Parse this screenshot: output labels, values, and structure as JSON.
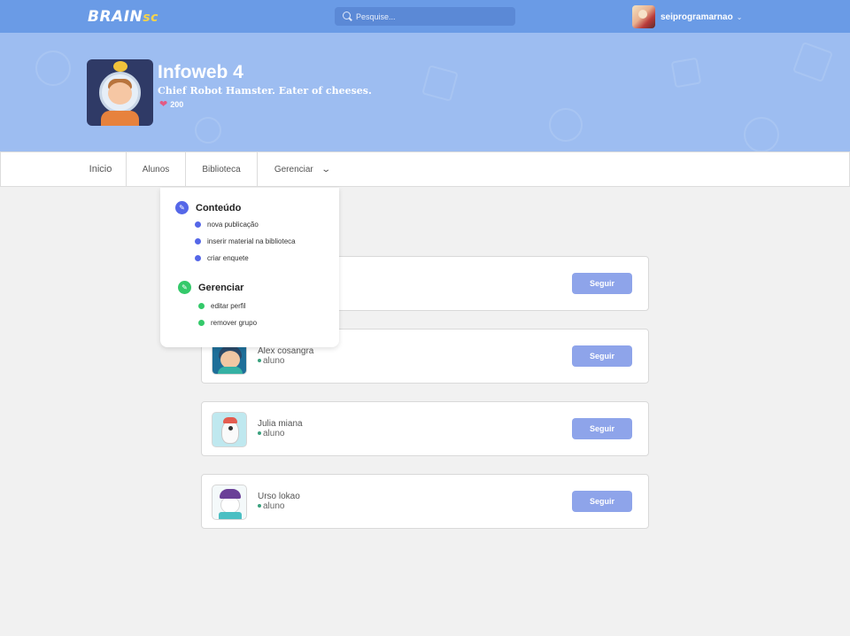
{
  "topbar": {
    "logo_main": "BRAIN",
    "logo_accent": "sc",
    "search_placeholder": "Pesquise...",
    "user_name": "seiprogramarnao"
  },
  "group": {
    "title": "Infoweb 4",
    "description": "Chief Robot Hamster. Eater of cheeses.",
    "likes": "200"
  },
  "tabs": [
    {
      "label": "Inicio"
    },
    {
      "label": "Alunos"
    },
    {
      "label": "Biblioteca"
    },
    {
      "label": "Gerenciar"
    }
  ],
  "dropdown": {
    "sections": [
      {
        "title": "Conteúdo",
        "items": [
          "nova publicação",
          "inserir material na biblioteca",
          "criar enquete"
        ]
      },
      {
        "title": "Gerenciar",
        "items": [
          "editar perfil",
          "remover grupo"
        ]
      }
    ]
  },
  "members": [
    {
      "name": "",
      "role": "",
      "follow_label": "Seguir"
    },
    {
      "name": "Alex cosangra",
      "role": "aluno",
      "follow_label": "Seguir"
    },
    {
      "name": "Julia miana",
      "role": "aluno",
      "follow_label": "Seguir"
    },
    {
      "name": "Urso lokao",
      "role": "aluno",
      "follow_label": "Seguir"
    }
  ],
  "colors": {
    "topbar": "#6a9be6",
    "banner": "#9dbdf1",
    "follow_button": "#8ea4ea",
    "content_accent": "#5567e8",
    "manage_accent": "#34c96a",
    "like_heart": "#e45a84"
  }
}
